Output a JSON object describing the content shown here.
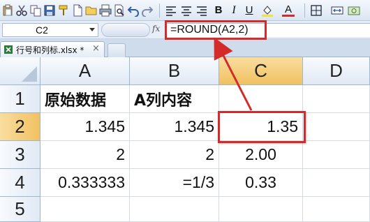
{
  "toolbar": {
    "icons": [
      "paste-icon",
      "cut-icon",
      "copy-icon",
      "format-painter-icon",
      "new-icon",
      "open-icon",
      "save-icon",
      "print-icon",
      "print-preview-icon",
      "undo-icon",
      "redo-icon",
      "align-left-icon",
      "align-center-icon",
      "align-right-icon",
      "bold-icon",
      "italic-icon",
      "underline-icon",
      "fill-color-icon",
      "font-color-icon",
      "borders-icon",
      "merge-icon",
      "currency-icon"
    ],
    "bold_label": "B",
    "italic_label": "I",
    "underline_label": "U",
    "font_color_label": "A",
    "font_color_accent": "#d42a2a"
  },
  "formula_bar": {
    "name_box": "C2",
    "fx_label": "fx",
    "formula": "=ROUND(A2,2)"
  },
  "tabs": [
    {
      "label": "行号和列标.xlsx *",
      "close": "×"
    }
  ],
  "grid": {
    "columns": [
      "A",
      "B",
      "C",
      "D"
    ],
    "selected_column": "C",
    "rows": [
      "1",
      "2",
      "3",
      "4",
      "5"
    ],
    "selected_row": "2",
    "cells": {
      "A1": "原始数据",
      "B1": "A列内容",
      "C1": "",
      "A2": "1.345",
      "B2": "1.345",
      "C2": "1.35",
      "A3": "2",
      "B3": "2",
      "C3": "2.00",
      "A4": "0.333333",
      "B4": "=1/3",
      "C4": "0.33"
    }
  },
  "colors": {
    "highlight": "#d42a2a",
    "selected_header": "#f1c15f",
    "header_bg": "#e1e9f4"
  }
}
